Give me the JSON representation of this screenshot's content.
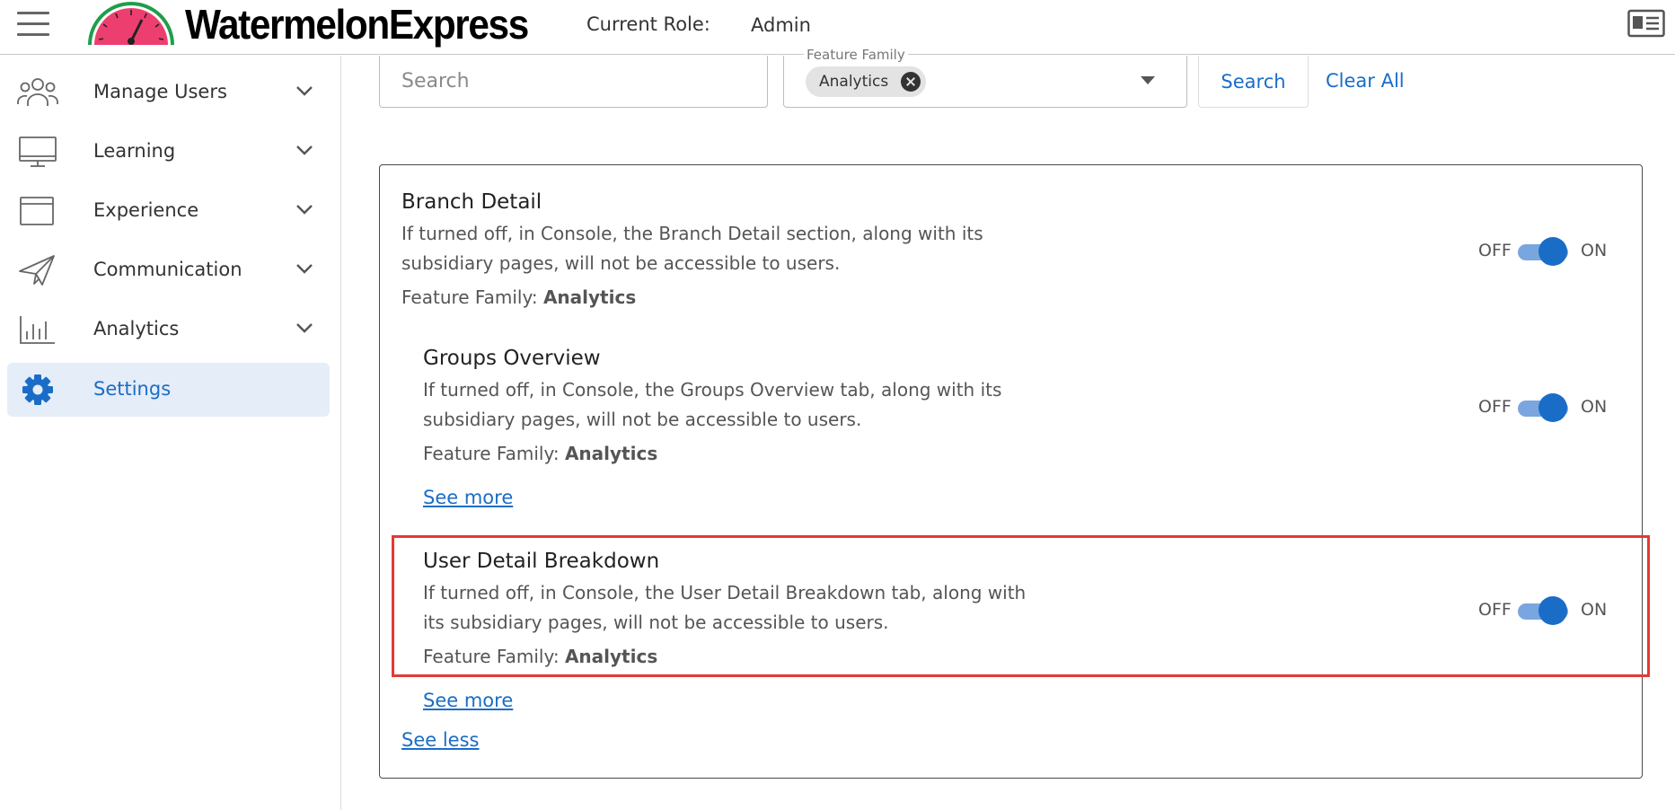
{
  "header": {
    "brand": "WatermelonExpress",
    "role_label": "Current Role:",
    "role_value": "Admin"
  },
  "sidebar": {
    "items": [
      {
        "label": "Manage Users",
        "icon": "users-icon"
      },
      {
        "label": "Learning",
        "icon": "monitor-icon"
      },
      {
        "label": "Experience",
        "icon": "browser-window-icon"
      },
      {
        "label": "Communication",
        "icon": "paper-plane-icon"
      },
      {
        "label": "Analytics",
        "icon": "bar-chart-icon"
      },
      {
        "label": "Settings",
        "icon": "gear-icon",
        "active": true
      }
    ]
  },
  "filters": {
    "search_placeholder": "Search",
    "family_label": "Feature Family",
    "family_chip": "Analytics",
    "search_button": "Search",
    "clear_button": "Clear All"
  },
  "features": [
    {
      "title": "Branch Detail",
      "description": "If turned off, in Console, the Branch Detail section, along with its subsidiary pages, will not be accessible to users.",
      "family_prefix": "Feature Family: ",
      "family": "Analytics",
      "off_label": "OFF",
      "on_label": "ON",
      "enabled": true
    },
    {
      "title": "Groups Overview",
      "description": "If turned off, in Console, the Groups Overview tab, along with its subsidiary pages, will not be accessible to users.",
      "family_prefix": "Feature Family: ",
      "family": "Analytics",
      "see_more": "See more",
      "off_label": "OFF",
      "on_label": "ON",
      "enabled": true
    },
    {
      "title": "User Detail Breakdown",
      "description": "If turned off, in Console, the User Detail Breakdown tab, along with its subsidiary pages, will not be accessible to users.",
      "family_prefix": "Feature Family: ",
      "family": "Analytics",
      "see_more": "See more",
      "off_label": "OFF",
      "on_label": "ON",
      "enabled": true
    }
  ],
  "see_less": "See less",
  "colors": {
    "accent": "#1a6dc7",
    "toggle_track": "#7aa6e0",
    "active_nav_bg": "#e5edf8",
    "highlight": "#e53935"
  }
}
